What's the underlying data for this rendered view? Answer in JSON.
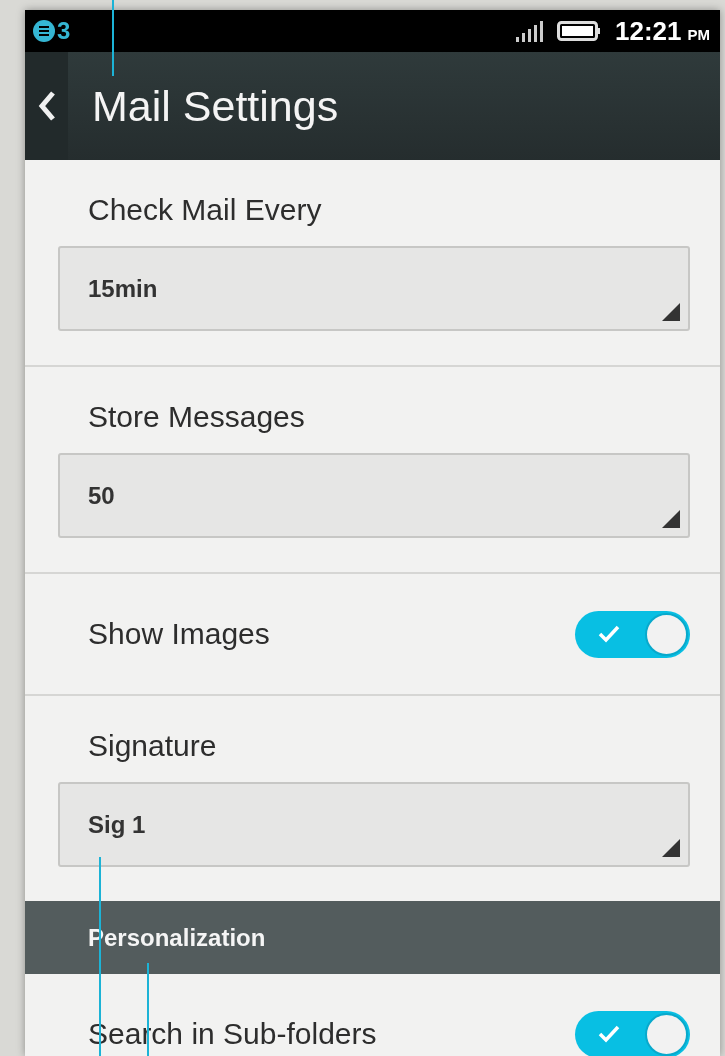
{
  "status_bar": {
    "notification_count": "3",
    "time": "12:21",
    "period": "PM"
  },
  "header": {
    "title": "Mail Settings"
  },
  "settings": [
    {
      "kind": "select",
      "label": "Check Mail Every",
      "value": "15min"
    },
    {
      "kind": "select",
      "label": "Store Messages",
      "value": "50"
    },
    {
      "kind": "toggle",
      "label": "Show Images",
      "on": true
    },
    {
      "kind": "select",
      "label": "Signature",
      "value": "Sig 1"
    },
    {
      "kind": "section",
      "label": "Personalization"
    },
    {
      "kind": "toggle",
      "label": "Search in Sub-folders",
      "on": true
    }
  ]
}
